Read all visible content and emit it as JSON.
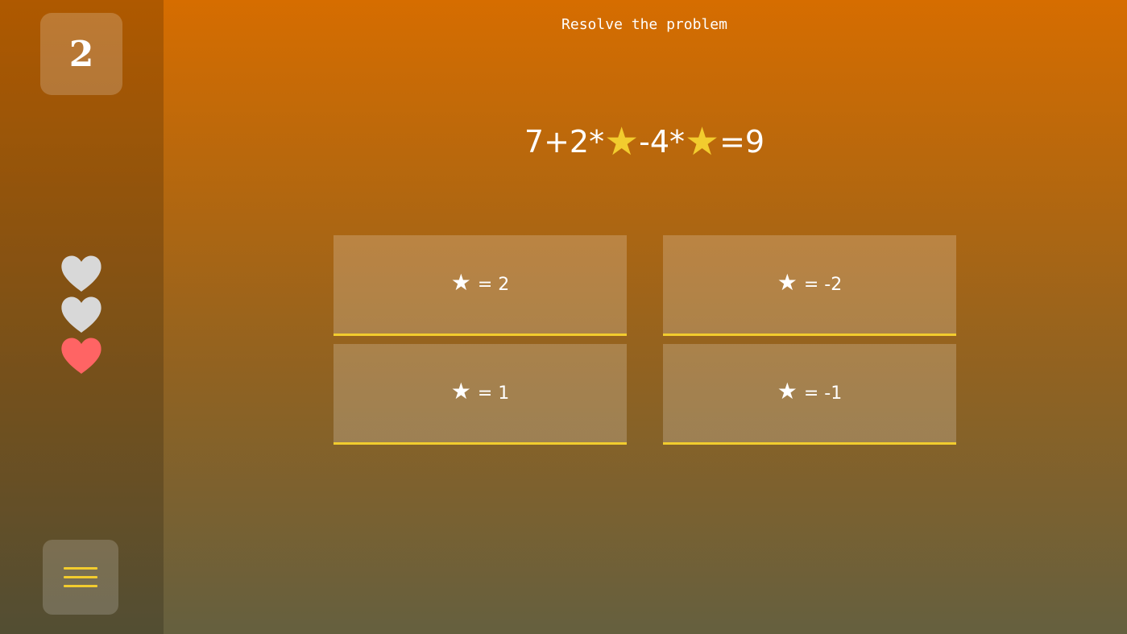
{
  "level": "2",
  "title": "Resolve the problem",
  "equation": {
    "parts": [
      "7+2*",
      "-4*",
      "=9"
    ],
    "symbol": "★"
  },
  "lives": [
    {
      "state": "lost",
      "color": "#d8d8d8"
    },
    {
      "state": "lost",
      "color": "#d8d8d8"
    },
    {
      "state": "full",
      "color": "#ff6464"
    }
  ],
  "answers": [
    {
      "symbol": "★",
      "label": "= 2"
    },
    {
      "symbol": "★",
      "label": "= -2"
    },
    {
      "symbol": "★",
      "label": "= 1"
    },
    {
      "symbol": "★",
      "label": "= -1"
    }
  ],
  "menu": {
    "icon": "hamburger-menu-icon"
  },
  "colors": {
    "accent": "#f2cc2e",
    "heart_full": "#ff6464",
    "heart_lost": "#d8d8d8"
  }
}
